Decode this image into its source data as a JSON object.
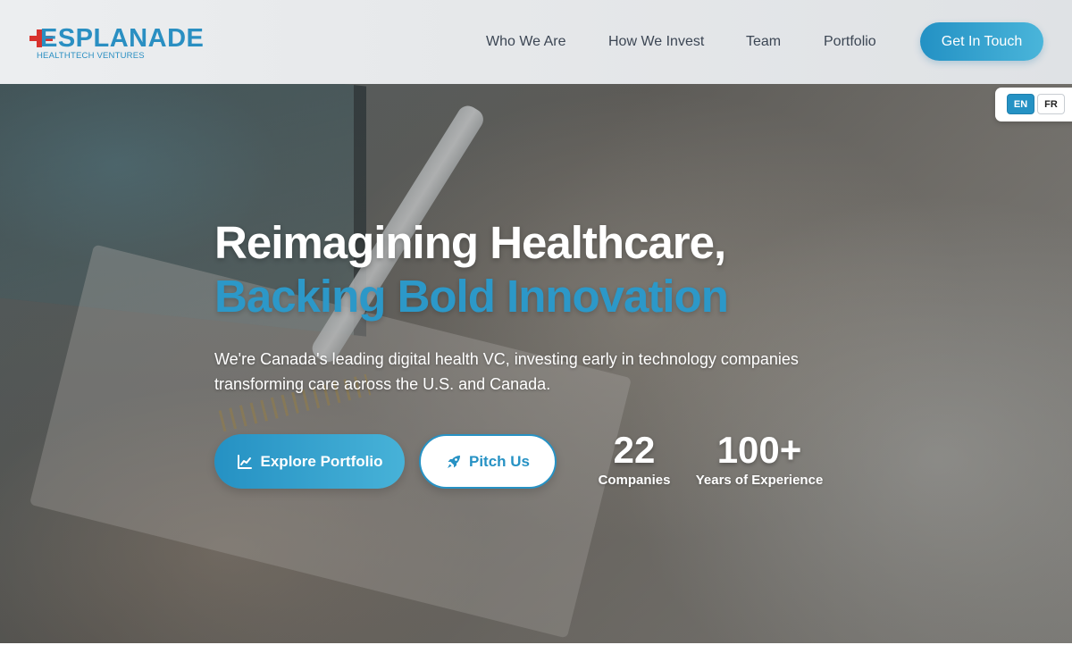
{
  "brand": {
    "name": "ESPLANADE",
    "tagline": "HEALTHTECH VENTURES",
    "colors": {
      "primary": "#2a8fc2",
      "cross": "#d8322e"
    }
  },
  "nav": {
    "items": [
      {
        "label": "Who We Are"
      },
      {
        "label": "How We Invest"
      },
      {
        "label": "Team"
      },
      {
        "label": "Portfolio"
      }
    ],
    "cta_label": "Get In Touch"
  },
  "language": {
    "options": [
      "EN",
      "FR"
    ],
    "selected": "EN"
  },
  "hero": {
    "title_line1": "Reimagining Healthcare,",
    "title_line2": "Backing Bold Innovation",
    "description": "We're Canada's leading digital health VC, investing early in technology companies transforming care across the U.S. and Canada.",
    "primary_button": {
      "label": "Explore Portfolio",
      "icon": "chart-line-icon"
    },
    "secondary_button": {
      "label": "Pitch Us",
      "icon": "rocket-icon"
    },
    "stats": [
      {
        "value": "22",
        "label": "Companies"
      },
      {
        "value": "100+",
        "label": "Years of Experience"
      }
    ]
  }
}
